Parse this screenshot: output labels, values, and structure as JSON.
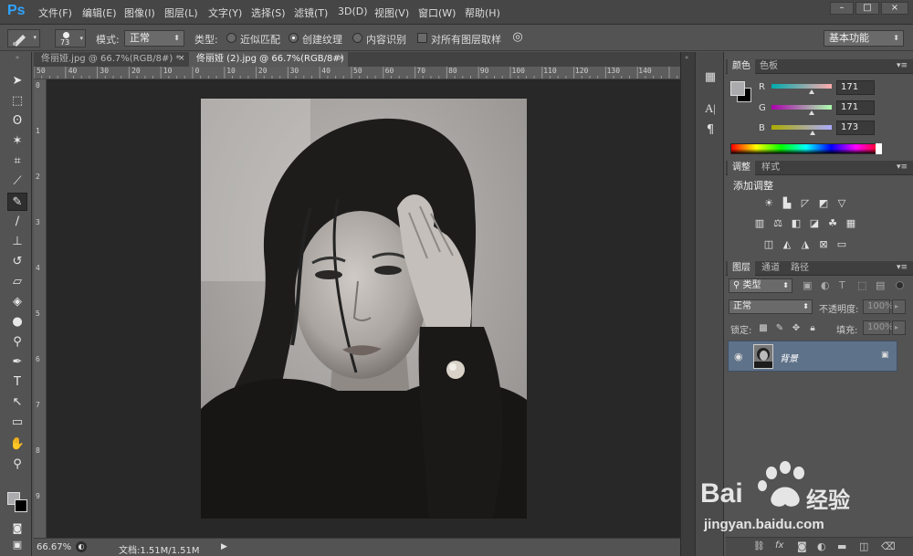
{
  "app": {
    "logo": "Ps"
  },
  "menu": [
    "文件(F)",
    "编辑(E)",
    "图像(I)",
    "图层(L)",
    "文字(Y)",
    "选择(S)",
    "滤镜(T)",
    "3D(D)",
    "视图(V)",
    "窗口(W)",
    "帮助(H)"
  ],
  "window_buttons": [
    "–",
    "□",
    "×"
  ],
  "options": {
    "brush_size": "73",
    "mode_label": "模式:",
    "mode_value": "正常",
    "type_label": "类型:",
    "radio1": "近似匹配",
    "radio2": "创建纹理",
    "radio3": "内容识别",
    "checkbox": "对所有图层取样",
    "workspace": "基本功能"
  },
  "tabs": [
    {
      "label": "佟丽娅.jpg @ 66.7%(RGB/8#) *",
      "close": "×"
    },
    {
      "label": "佟丽娅 (2).jpg @ 66.7%(RGB/8#)",
      "close": "×"
    }
  ],
  "ruler_top": [
    "50",
    "40",
    "30",
    "20",
    "10",
    "0",
    "10",
    "20",
    "30",
    "40",
    "50",
    "60",
    "70",
    "80",
    "90",
    "100",
    "110",
    "120",
    "130",
    "140"
  ],
  "ruler_left": [
    "0",
    "1",
    "2",
    "3",
    "4",
    "5",
    "6",
    "7",
    "8",
    "9"
  ],
  "status": {
    "zoom": "66.67%",
    "doc": "文档:1.51M/1.51M"
  },
  "color_panel": {
    "tabs": [
      "颜色",
      "色板"
    ],
    "r_label": "R",
    "g_label": "G",
    "b_label": "B",
    "r": "171",
    "g": "171",
    "b": "173",
    "r_fraction": 0.67,
    "g_fraction": 0.67,
    "b_fraction": 0.68,
    "fg_color": "#ababad",
    "bg_color": "#000000"
  },
  "adjust_panel": {
    "tabs": [
      "调整",
      "样式"
    ],
    "title": "添加调整"
  },
  "layers_panel": {
    "tabs": [
      "图层",
      "通道",
      "路径"
    ],
    "filter": "类型",
    "blend": "正常",
    "opacity_label": "不透明度:",
    "opacity": "100%",
    "lock_label": "锁定:",
    "fill_label": "填充:",
    "fill": "100%",
    "layer_name": "背景"
  },
  "watermark": {
    "brand": "Bai",
    "brand_cn": "经验",
    "url": "jingyan.baidu.com"
  }
}
